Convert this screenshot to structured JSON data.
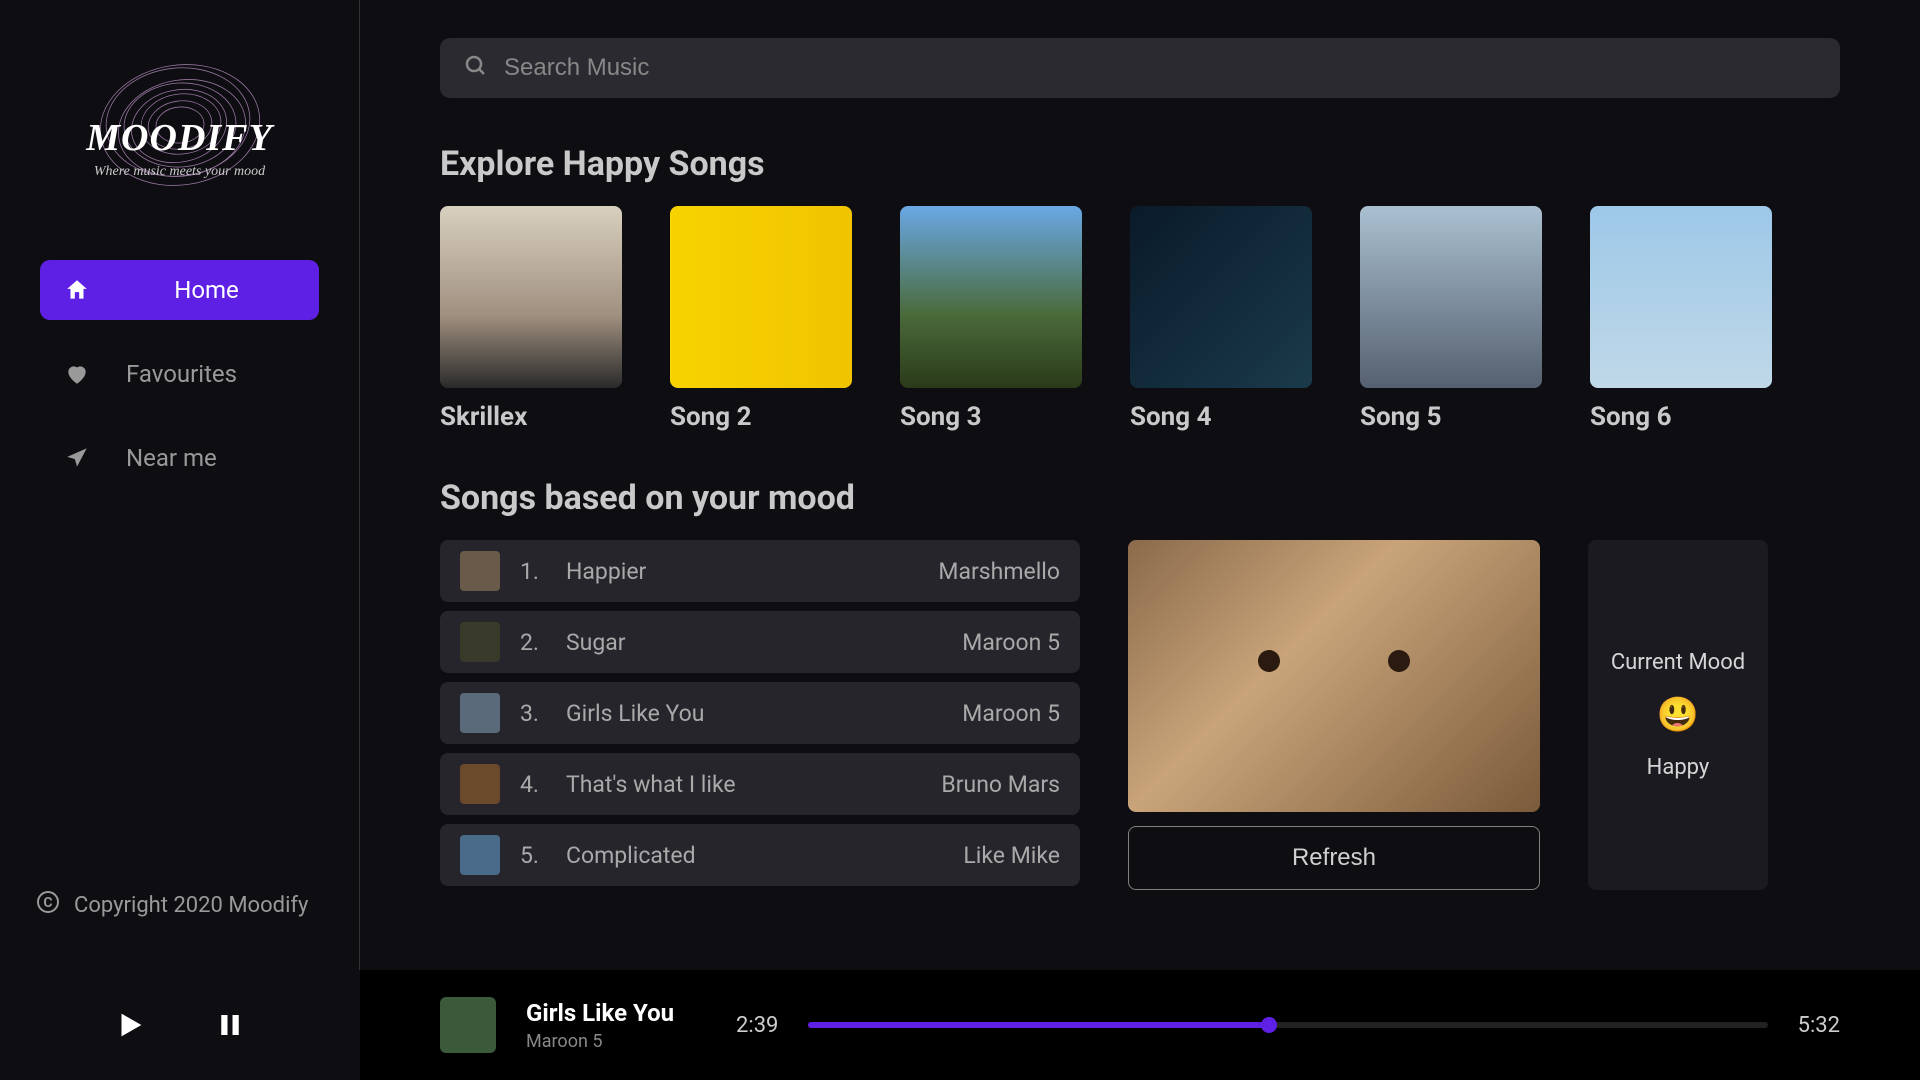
{
  "brand": {
    "name": "MOODIFY",
    "tagline": "Where music meets your mood"
  },
  "sidebar": {
    "items": [
      {
        "label": "Home",
        "active": true
      },
      {
        "label": "Favourites",
        "active": false
      },
      {
        "label": "Near me",
        "active": false
      }
    ]
  },
  "copyright": "Copyright 2020 Moodify",
  "search": {
    "placeholder": "Search Music"
  },
  "explore": {
    "heading": "Explore Happy Songs",
    "cards": [
      {
        "title": "Skrillex"
      },
      {
        "title": "Song 2"
      },
      {
        "title": "Song 3"
      },
      {
        "title": "Song 4"
      },
      {
        "title": "Song 5"
      },
      {
        "title": "Song 6"
      }
    ]
  },
  "moodSongs": {
    "heading": "Songs based on your mood",
    "list": [
      {
        "num": "1.",
        "name": "Happier",
        "artist": "Marshmello"
      },
      {
        "num": "2.",
        "name": "Sugar",
        "artist": "Maroon 5"
      },
      {
        "num": "3.",
        "name": "Girls Like You",
        "artist": "Maroon 5"
      },
      {
        "num": "4.",
        "name": "That's what I like",
        "artist": "Bruno Mars"
      },
      {
        "num": "5.",
        "name": "Complicated",
        "artist": "Like Mike"
      }
    ],
    "refresh_label": "Refresh",
    "current_mood_label": "Current Mood",
    "mood_emoji": "😃",
    "mood_name": "Happy"
  },
  "player": {
    "title": "Girls Like You",
    "artist": "Maroon 5",
    "current_time": "2:39",
    "total_time": "5:32",
    "progress_percent": 48
  },
  "colors": {
    "accent": "#5f20e6"
  }
}
